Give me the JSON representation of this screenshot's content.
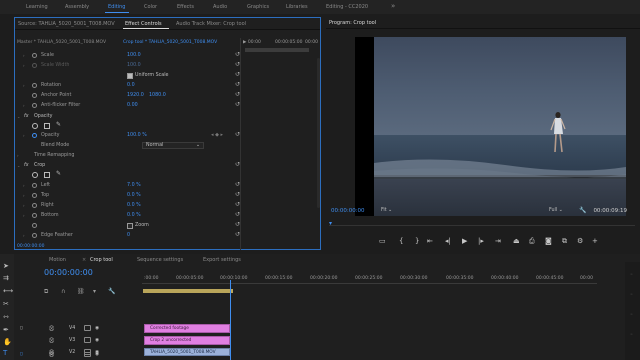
{
  "workspaces": [
    "Learning",
    "Assembly",
    "Editing",
    "Color",
    "Effects",
    "Audio",
    "Graphics",
    "Libraries",
    "Editing - CC2020",
    "»"
  ],
  "active_workspace": "Editing",
  "source_panel": {
    "tabs": [
      "Source: TAHLIA_5020_5001_T008.MOV",
      "Effect Controls",
      "Audio Track Mixer: Crop tool"
    ],
    "active_tab": "Effect Controls",
    "master_clip": "Master * TAHLIA_5020_5001_T008.MOV",
    "sequence_clip": "Crop tool * TAHLIA_5020_5001_T008.MOV",
    "ruler_times": [
      "▶ 00:00",
      "00:00:05:00",
      "00:00"
    ],
    "rows": {
      "scale_label": "Scale",
      "scale_value": "100.0",
      "scale_width_label": "Scale Width",
      "scale_width_value": "100.0",
      "uniform_scale": "Uniform Scale",
      "rotation_label": "Rotation",
      "rotation_value": "0.0",
      "anchor_label": "Anchor Point",
      "anchor_x": "1920.0",
      "anchor_y": "1080.0",
      "anti_flicker_label": "Anti-flicker Filter",
      "anti_flicker_value": "0.00",
      "opacity_section": "Opacity",
      "opacity_label": "Opacity",
      "opacity_value": "100.0 %",
      "blend_label": "Blend Mode",
      "blend_value": "Normal",
      "time_remap": "Time Remapping",
      "crop_section": "Crop",
      "left_label": "Left",
      "left_value": "7.0 %",
      "top_label": "Top",
      "top_value": "0.0 %",
      "right_label": "Right",
      "right_value": "0.0 %",
      "bottom_label": "Bottom",
      "bottom_value": "0.0 %",
      "zoom_label": "Zoom",
      "feather_label": "Edge Feather",
      "feather_value": "0",
      "fx_badge": "fx"
    },
    "bottom_timecode": "00:00:00:00"
  },
  "program": {
    "title": "Program: Crop tool",
    "timecode": "00:00:00:00",
    "fit": "Fit",
    "quality": "Full",
    "duration": "00:00:09:19"
  },
  "timeline": {
    "tabs": [
      "Motion",
      "Crop tool",
      "Sequence settings",
      "Export settings"
    ],
    "active_tab": "Crop tool",
    "timecode": "00:00:00:00",
    "ticks": [
      ":00:00",
      "00:00:05:00",
      "00:00:10:00",
      "00:00:15:00",
      "00:00:20:00",
      "00:00:25:00",
      "00:00:30:00",
      "00:00:35:00",
      "00:00:40:00",
      "00:00:45:00",
      "00:00"
    ],
    "tracks": [
      {
        "name": "V4",
        "clip": ""
      },
      {
        "name": "V3",
        "clip": "Corrected footage"
      },
      {
        "name": "V2",
        "clip": "Crop 2 uncorrected"
      },
      {
        "name": "V1",
        "clip": "TAHLIA_5020_5001_T008.MOV"
      }
    ]
  },
  "colors": {
    "accent": "#3f8ef0",
    "clip_pink": "#e07fe1",
    "clip_blue": "#9bb1d9"
  }
}
